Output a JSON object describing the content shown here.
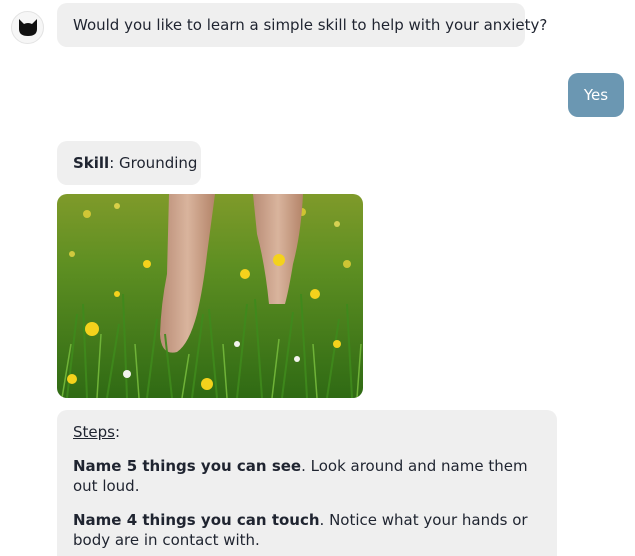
{
  "messages": {
    "bot_question": "Would you like to learn a simple skill to help with your anxiety?",
    "user_reply": "Yes",
    "skill_label": "Skill",
    "skill_sep": ": ",
    "skill_name": "Grounding",
    "steps_label": "Steps",
    "steps_colon": ":",
    "steps": [
      {
        "title": "Name 5 things you can see",
        "detail": ". Look around and name them out loud."
      },
      {
        "title": "Name 4 things you can touch",
        "detail": ". Notice what your hands or body are in contact with."
      }
    ]
  },
  "icons": {
    "avatar": "cat-face-icon",
    "photo": "feet-in-grass-image"
  },
  "colors": {
    "bot_bubble": "#efefef",
    "user_bubble": "#6b97b2",
    "text": "#1f2430"
  }
}
